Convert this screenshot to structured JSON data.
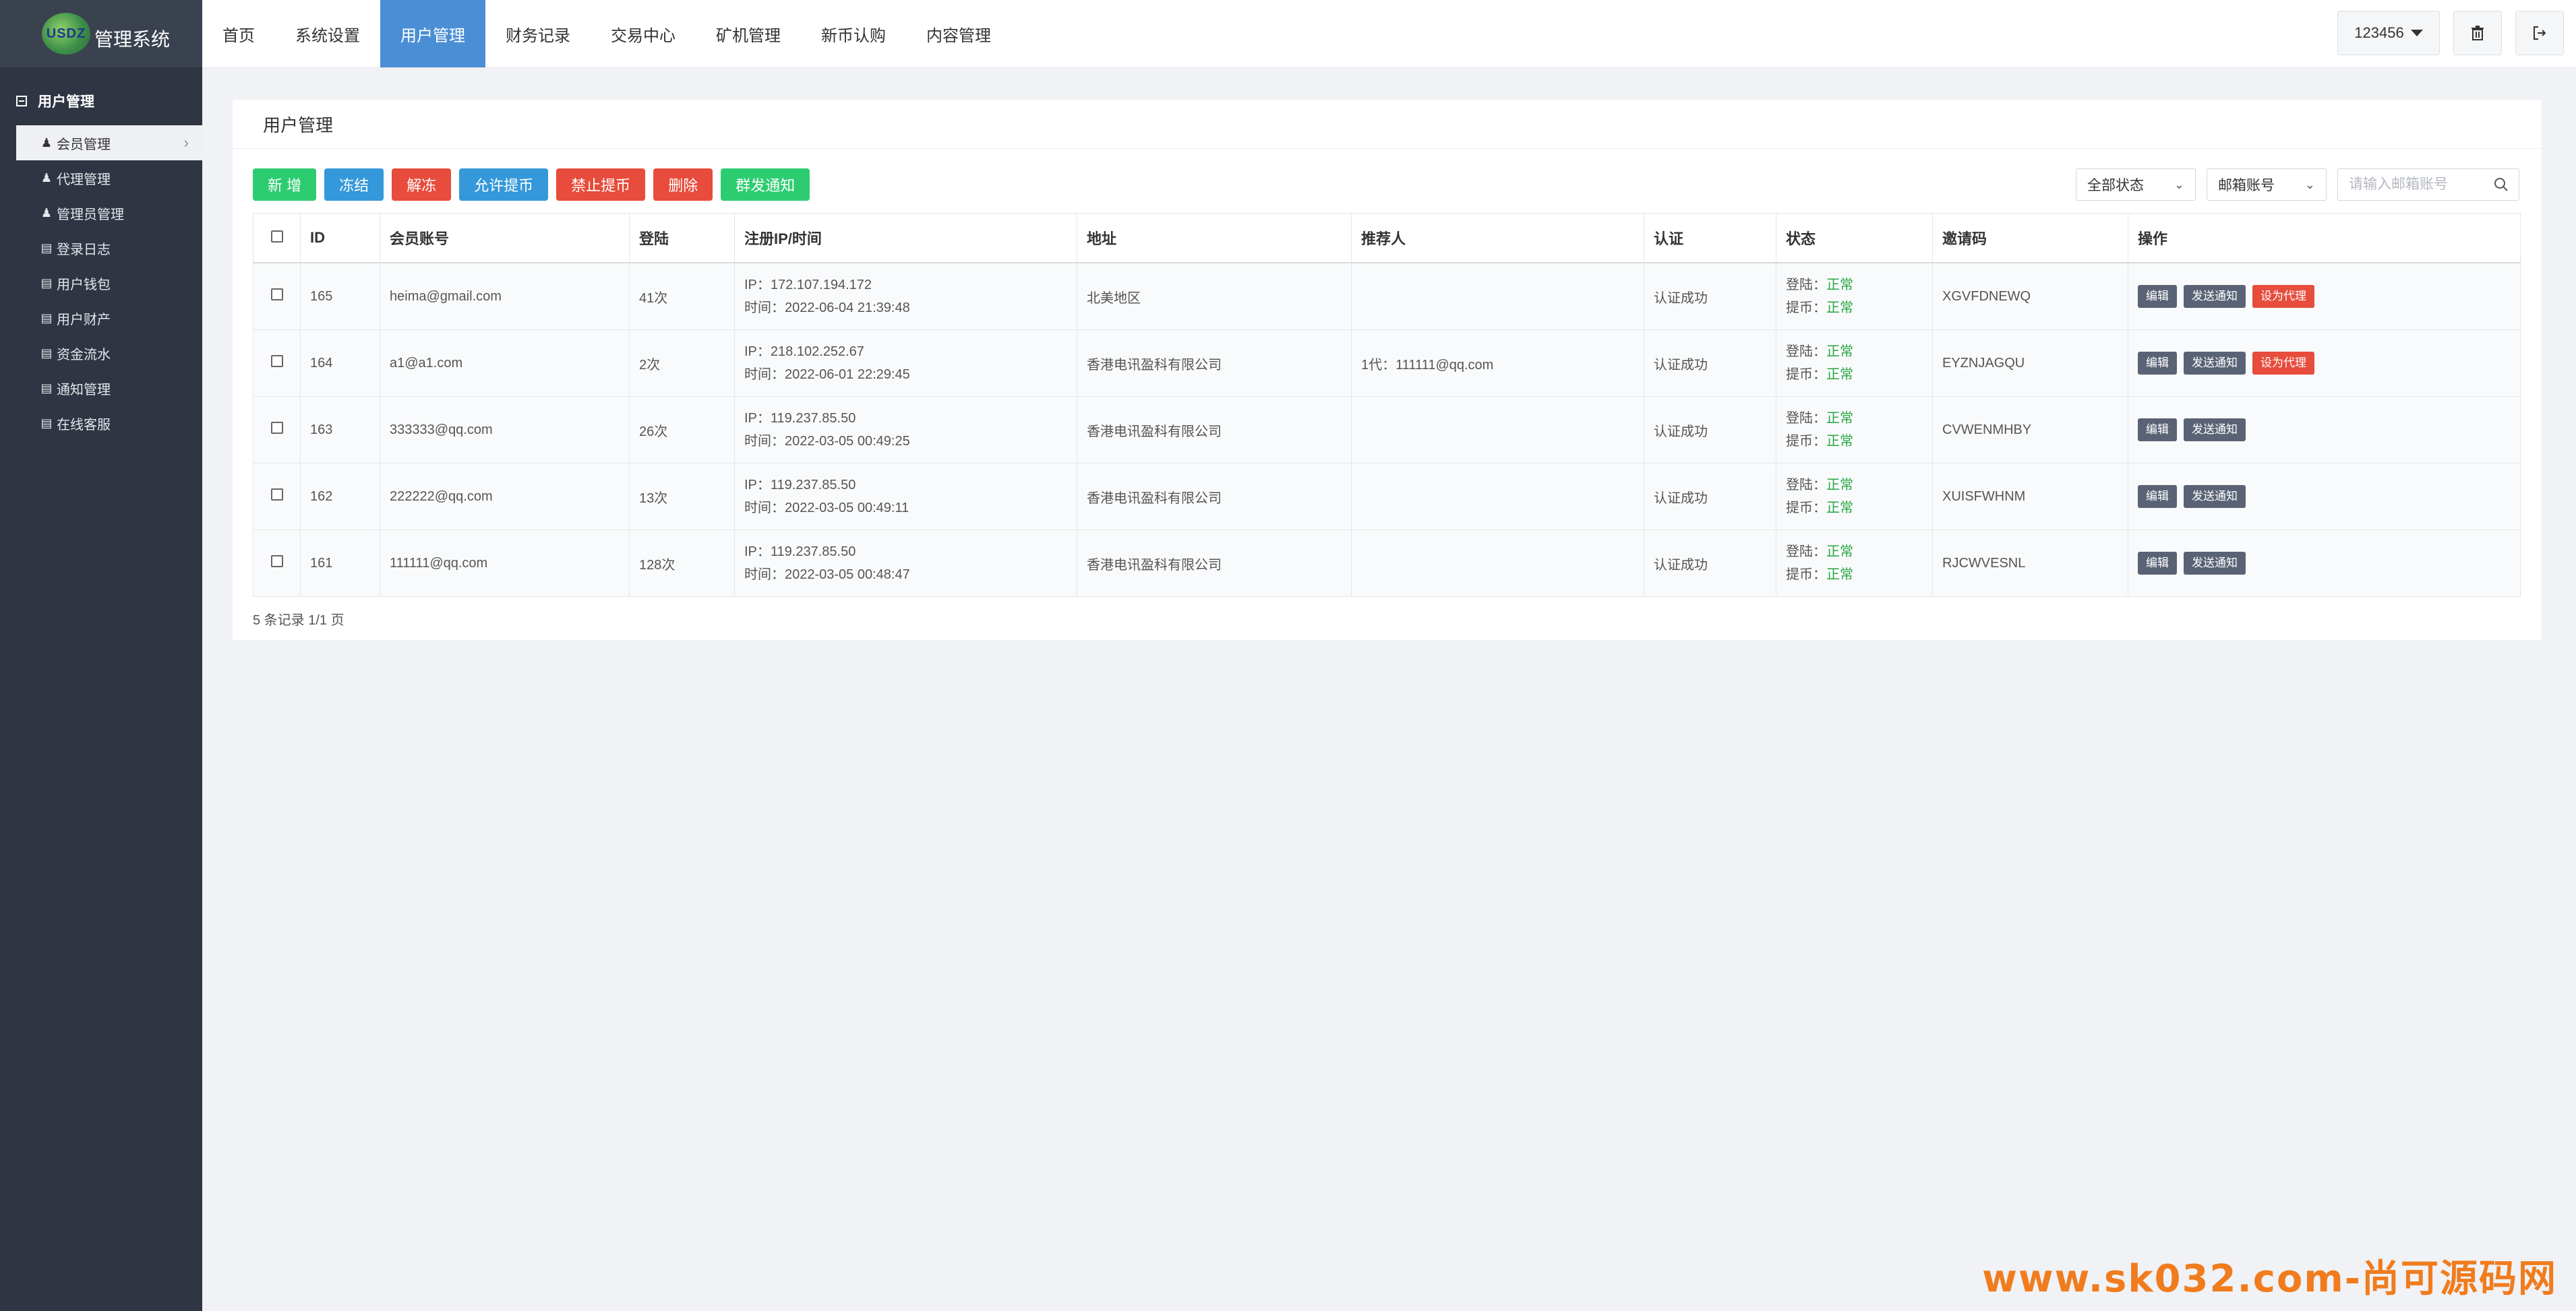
{
  "app": {
    "logo_text": "USDZ",
    "title": "管理系统"
  },
  "topnav": {
    "items": [
      {
        "label": "首页"
      },
      {
        "label": "系统设置"
      },
      {
        "label": "用户管理"
      },
      {
        "label": "财务记录"
      },
      {
        "label": "交易中心"
      },
      {
        "label": "矿机管理"
      },
      {
        "label": "新币认购"
      },
      {
        "label": "内容管理"
      }
    ],
    "active": "用户管理",
    "user": "123456",
    "accent_color": "#4a8fd6"
  },
  "sidebar": {
    "group": "用户管理",
    "items": [
      {
        "label": "会员管理",
        "icon": "user-icon"
      },
      {
        "label": "代理管理",
        "icon": "user-icon"
      },
      {
        "label": "管理员管理",
        "icon": "user-icon"
      },
      {
        "label": "登录日志",
        "icon": "list-icon"
      },
      {
        "label": "用户钱包",
        "icon": "list-icon"
      },
      {
        "label": "用户财产",
        "icon": "list-icon"
      },
      {
        "label": "资金流水",
        "icon": "list-icon"
      },
      {
        "label": "通知管理",
        "icon": "list-icon"
      },
      {
        "label": "在线客服",
        "icon": "list-icon"
      }
    ]
  },
  "page": {
    "title": "用户管理",
    "toolbar": {
      "add": "新 增",
      "freeze": "冻结",
      "unfreeze": "解冻",
      "allow_withdraw": "允许提币",
      "forbid_withdraw": "禁止提币",
      "delete": "删除",
      "broadcast": "群发通知"
    },
    "filters": {
      "status": "全部状态",
      "field": "邮箱账号",
      "search_placeholder": "请输入邮箱账号"
    },
    "table": {
      "headers": {
        "id": "ID",
        "account": "会员账号",
        "logins": "登陆",
        "reg": "注册IP/时间",
        "address": "地址",
        "referrer": "推荐人",
        "auth": "认证",
        "status": "状态",
        "invite": "邀请码",
        "ops": "操作"
      },
      "rows": [
        {
          "id": "165",
          "account": "heima@gmail.com",
          "logins": "41次",
          "ip": "IP：172.107.194.172",
          "time": "时间：2022-06-04 21:39:48",
          "address": "北美地区",
          "referrer": "",
          "auth": "认证成功",
          "login_status_label": "登陆：",
          "login_status": "正常",
          "withdraw_status_label": "提币：",
          "withdraw_status": "正常",
          "invite": "XGVFDNEWQ",
          "edit": "编辑",
          "notify": "发送通知",
          "agent": "设为代理"
        },
        {
          "id": "164",
          "account": "a1@a1.com",
          "logins": "2次",
          "ip": "IP：218.102.252.67",
          "time": "时间：2022-06-01 22:29:45",
          "address": "香港电讯盈科有限公司",
          "referrer": "1代：111111@qq.com",
          "auth": "认证成功",
          "login_status_label": "登陆：",
          "login_status": "正常",
          "withdraw_status_label": "提币：",
          "withdraw_status": "正常",
          "invite": "EYZNJAGQU",
          "edit": "编辑",
          "notify": "发送通知",
          "agent": "设为代理"
        },
        {
          "id": "163",
          "account": "333333@qq.com",
          "logins": "26次",
          "ip": "IP：119.237.85.50",
          "time": "时间：2022-03-05 00:49:25",
          "address": "香港电讯盈科有限公司",
          "referrer": "",
          "auth": "认证成功",
          "login_status_label": "登陆：",
          "login_status": "正常",
          "withdraw_status_label": "提币：",
          "withdraw_status": "正常",
          "invite": "CVWENMHBY",
          "edit": "编辑",
          "notify": "发送通知",
          "agent": ""
        },
        {
          "id": "162",
          "account": "222222@qq.com",
          "logins": "13次",
          "ip": "IP：119.237.85.50",
          "time": "时间：2022-03-05 00:49:11",
          "address": "香港电讯盈科有限公司",
          "referrer": "",
          "auth": "认证成功",
          "login_status_label": "登陆：",
          "login_status": "正常",
          "withdraw_status_label": "提币：",
          "withdraw_status": "正常",
          "invite": "XUISFWHNM",
          "edit": "编辑",
          "notify": "发送通知",
          "agent": ""
        },
        {
          "id": "161",
          "account": "111111@qq.com",
          "logins": "128次",
          "ip": "IP：119.237.85.50",
          "time": "时间：2022-03-05 00:48:47",
          "address": "香港电讯盈科有限公司",
          "referrer": "",
          "auth": "认证成功",
          "login_status_label": "登陆：",
          "login_status": "正常",
          "withdraw_status_label": "提币：",
          "withdraw_status": "正常",
          "invite": "RJCWVESNL",
          "edit": "编辑",
          "notify": "发送通知",
          "agent": ""
        }
      ]
    },
    "pagination": "5 条记录 1/1 页"
  },
  "watermark": "www.sk032.com-尚可源码网"
}
